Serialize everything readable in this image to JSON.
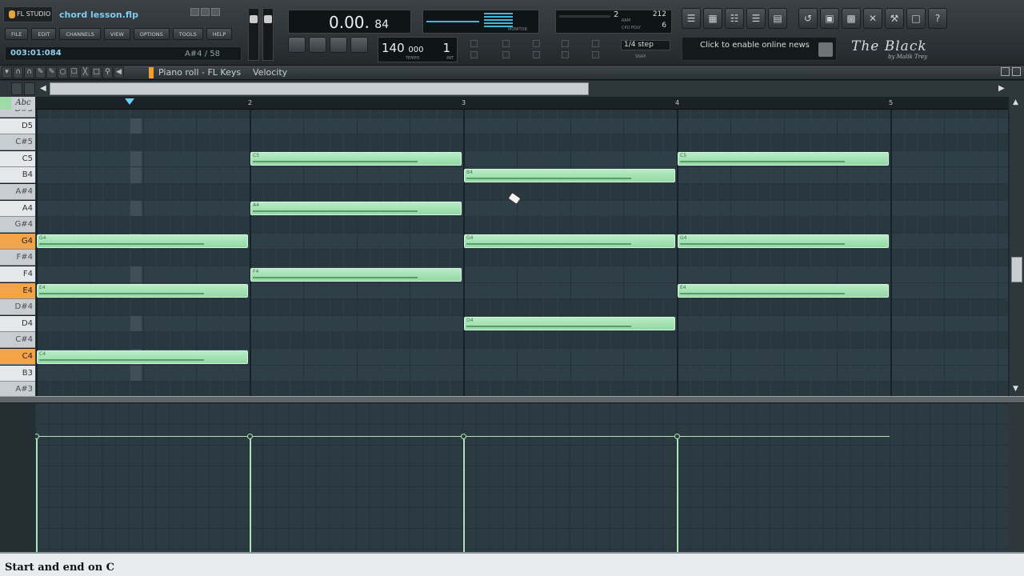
{
  "app": {
    "logo": "FL STUDIO",
    "project_title": "chord lesson.flp",
    "menu": [
      "FILE",
      "EDIT",
      "CHANNELS",
      "VIEW",
      "OPTIONS",
      "TOOLS",
      "HELP"
    ],
    "song_position": "003:01:084",
    "note_info": "A#4 / 58"
  },
  "transport": {
    "time_main": "0.00.",
    "time_ms": "84",
    "tempo": "140",
    "tempo_decimal": "000",
    "tempo_label": "TEMPO",
    "pattern": "1",
    "pattern_label": "PAT",
    "monitor_label": "MONITOR",
    "cpu_num1": "2",
    "cpu_num2": "212",
    "cpu_num3": "6",
    "ram_label": "RAM",
    "cpu_label": "CPU  POLY",
    "snap_value": "1/4 step",
    "snap_label": "SNAP"
  },
  "news": {
    "text": "Click to enable online news"
  },
  "brand": {
    "line1": "The Black",
    "line2": "by Malik Trey"
  },
  "piano_roll": {
    "title": "Piano roll - FL Keys",
    "parameter": "Velocity",
    "abc_label": "Abc",
    "bar_numbers": [
      "2",
      "3",
      "4",
      "5"
    ],
    "keys": [
      {
        "name": "D#5",
        "type": "black"
      },
      {
        "name": "D5",
        "type": "white"
      },
      {
        "name": "C#5",
        "type": "black"
      },
      {
        "name": "C5",
        "type": "white"
      },
      {
        "name": "B4",
        "type": "white"
      },
      {
        "name": "A#4",
        "type": "black"
      },
      {
        "name": "A4",
        "type": "white"
      },
      {
        "name": "G#4",
        "type": "black"
      },
      {
        "name": "G4",
        "type": "white",
        "highlight": true
      },
      {
        "name": "F#4",
        "type": "black"
      },
      {
        "name": "F4",
        "type": "white"
      },
      {
        "name": "E4",
        "type": "white",
        "highlight": true
      },
      {
        "name": "D#4",
        "type": "black"
      },
      {
        "name": "D4",
        "type": "white"
      },
      {
        "name": "C#4",
        "type": "black"
      },
      {
        "name": "C4",
        "type": "white",
        "highlight": true
      },
      {
        "name": "B3",
        "type": "white"
      },
      {
        "name": "A#3",
        "type": "black"
      }
    ],
    "notes": [
      {
        "pitch": "G4",
        "bar": 1,
        "length_bars": 1,
        "label": "G4"
      },
      {
        "pitch": "E4",
        "bar": 1,
        "length_bars": 1,
        "label": "E4"
      },
      {
        "pitch": "C4",
        "bar": 1,
        "length_bars": 1,
        "label": "C4"
      },
      {
        "pitch": "C5",
        "bar": 2,
        "length_bars": 1,
        "label": "C5"
      },
      {
        "pitch": "A4",
        "bar": 2,
        "length_bars": 1,
        "label": "A4"
      },
      {
        "pitch": "F4",
        "bar": 2,
        "length_bars": 1,
        "label": "F4"
      },
      {
        "pitch": "B4",
        "bar": 3,
        "length_bars": 1,
        "label": "B4"
      },
      {
        "pitch": "G4",
        "bar": 3,
        "length_bars": 1,
        "label": "G4"
      },
      {
        "pitch": "D4",
        "bar": 3,
        "length_bars": 1,
        "label": "D4"
      },
      {
        "pitch": "C5",
        "bar": 4,
        "length_bars": 1,
        "label": "C5"
      },
      {
        "pitch": "G4",
        "bar": 4,
        "length_bars": 1,
        "label": "G4"
      },
      {
        "pitch": "E4",
        "bar": 4,
        "length_bars": 1,
        "label": "E4"
      }
    ]
  },
  "caption": {
    "text": "Start and end on C"
  },
  "colors": {
    "note_fill": "#a6e2b4",
    "grid_bg": "#2f3f47",
    "key_highlight": "#f3a348",
    "accent_blue": "#7ecbf0"
  }
}
